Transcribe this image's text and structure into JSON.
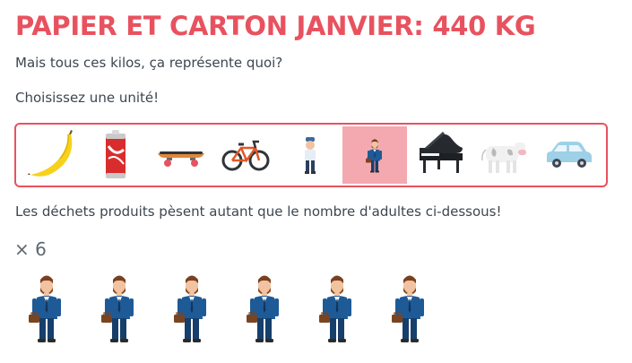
{
  "header": {
    "title": "PAPIER ET CARTON JANVIER: 440 KG",
    "subtitle": "Mais tous ces kilos, ça représente quoi?",
    "choose_prompt": "Choisissez une unité!"
  },
  "units": {
    "items": [
      {
        "icon": "banana-icon"
      },
      {
        "icon": "soda-can-icon"
      },
      {
        "icon": "skateboard-icon"
      },
      {
        "icon": "bicycle-icon"
      },
      {
        "icon": "child-icon"
      },
      {
        "icon": "adult-icon",
        "selected": true
      },
      {
        "icon": "grand-piano-icon"
      },
      {
        "icon": "cow-icon"
      },
      {
        "icon": "car-icon"
      }
    ],
    "selected_index": 5
  },
  "result": {
    "text": "Les déchets produits pèsent autant que le nombre d'adultes ci-dessous!",
    "multiplier": "× 6",
    "count": 6,
    "icon": "adult-icon"
  },
  "colors": {
    "accent": "#e8525f",
    "selected_bg": "#f4a9b1",
    "text": "#3d4650"
  }
}
